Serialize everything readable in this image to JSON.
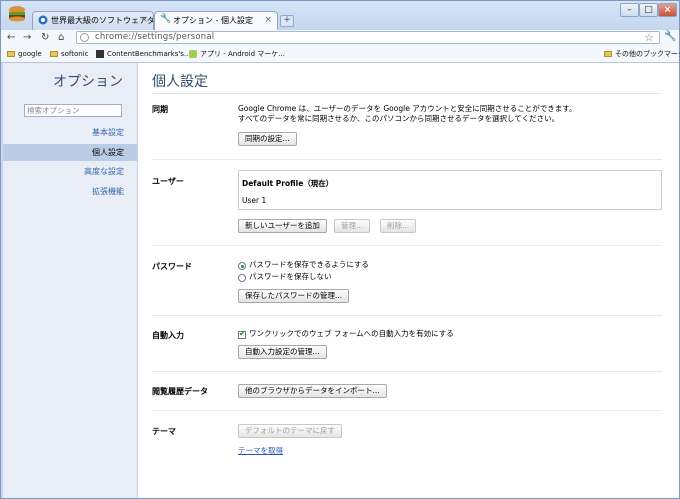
{
  "tabs": [
    {
      "label": "世界最大級のソフトウェアダウ"
    },
    {
      "label": "オプション - 個人設定"
    }
  ],
  "omnibox": {
    "url": "chrome://settings/personal"
  },
  "bookmarks": [
    {
      "label": "google"
    },
    {
      "label": "softonic"
    },
    {
      "label": "ContentBenchmarks's..."
    },
    {
      "label": "アプリ - Android マーケ..."
    }
  ],
  "other_bookmarks": "その他のブックマーク",
  "sidebar": {
    "title": "オプション",
    "search_placeholder": "検索オプション",
    "items": [
      {
        "label": "基本設定"
      },
      {
        "label": "個人設定"
      },
      {
        "label": "高度な設定"
      },
      {
        "label": "拡張機能"
      }
    ]
  },
  "main": {
    "title": "個人設定",
    "sync": {
      "label": "同期",
      "line1": "Google Chrome は、ユーザーのデータを Google アカウントと安全に同期させることができます。",
      "line2": "すべてのデータを常に同期させるか、このパソコンから同期させるデータを選択してください。",
      "button": "同期の設定..."
    },
    "users": {
      "label": "ユーザー",
      "profile_name": "Default Profile（現在）",
      "profile_user": "User 1",
      "add_button": "新しいユーザーを追加",
      "manage_button": "管理...",
      "delete_button": "削除..."
    },
    "passwords": {
      "label": "パスワード",
      "option_save": "パスワードを保存できるようにする",
      "option_nosave": "パスワードを保存しない",
      "button": "保存したパスワードの管理..."
    },
    "autofill": {
      "label": "自動入力",
      "checkbox": "ワンクリックでのウェブ フォームへの自動入力を有効にする",
      "button": "自動入力設定の管理..."
    },
    "browsing_data": {
      "label": "閲覧履歴データ",
      "button": "他のブラウザからデータをインポート..."
    },
    "themes": {
      "label": "テーマ",
      "button": "デフォルトのテーマに戻す",
      "link": "テーマを取得"
    }
  }
}
